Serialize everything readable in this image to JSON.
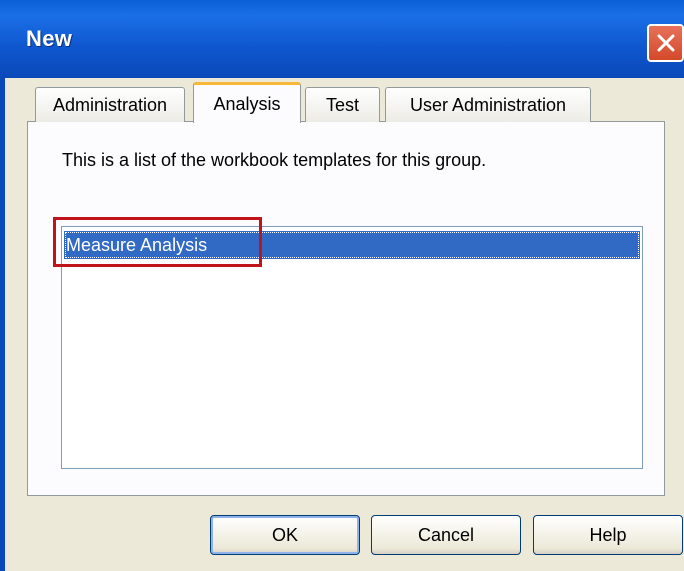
{
  "window": {
    "title": "New"
  },
  "tabs": [
    {
      "label": "Administration",
      "active": false
    },
    {
      "label": "Analysis",
      "active": true
    },
    {
      "label": "Test",
      "active": false
    },
    {
      "label": "User Administration",
      "active": false
    }
  ],
  "panel": {
    "description": "This is a list of the workbook templates for this group.",
    "list_items": [
      {
        "label": "Measure Analysis",
        "selected": true
      }
    ]
  },
  "buttons": {
    "ok": "OK",
    "cancel": "Cancel",
    "help": "Help"
  },
  "colors": {
    "titlebar": "#0a5fd8",
    "selection": "#316ac5",
    "highlight_box": "#c0141b",
    "tab_active_accent": "#f6b83b"
  }
}
